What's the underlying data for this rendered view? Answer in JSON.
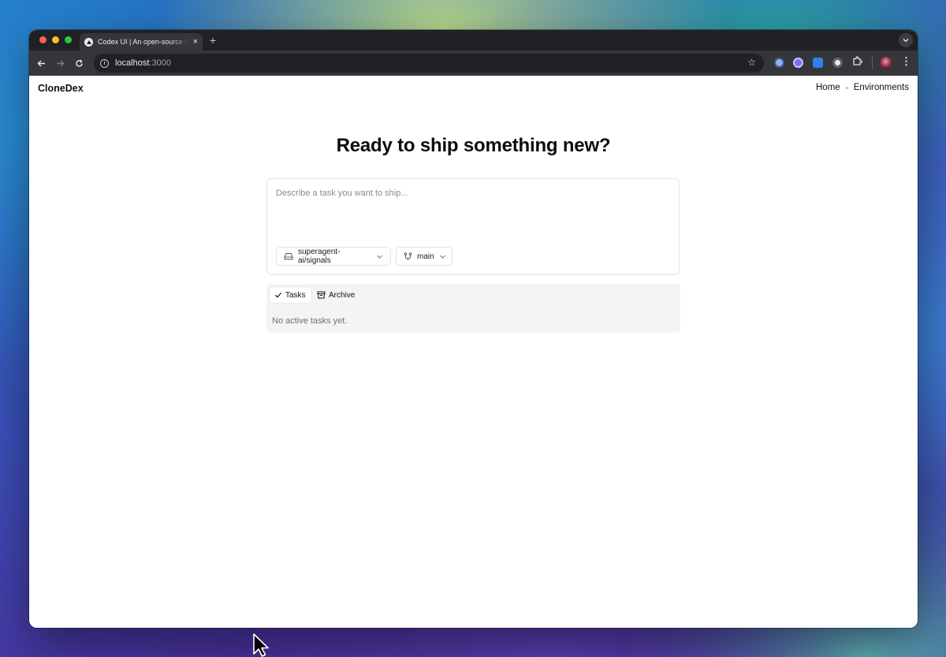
{
  "browser": {
    "tab_title": "Codex UI | An open-source O",
    "tab_close": "×",
    "new_tab": "+",
    "address_host": "localhost",
    "address_port": ":3000"
  },
  "header": {
    "brand": "CloneDex",
    "nav": [
      {
        "label": "Home"
      },
      {
        "label": "Environments"
      }
    ]
  },
  "hero": {
    "title": "Ready to ship something new?"
  },
  "composer": {
    "placeholder": "Describe a task you want to ship...",
    "value": "",
    "repo": "superagent-ai/signals",
    "branch": "main"
  },
  "tasks": {
    "tabs": [
      {
        "label": "Tasks",
        "active": true
      },
      {
        "label": "Archive",
        "active": false
      }
    ],
    "empty_text": "No active tasks yet."
  },
  "icons": {
    "back": "arrow-left-icon",
    "forward": "arrow-right-icon",
    "reload": "reload-icon",
    "bookmark": "star-icon",
    "extensions": "puzzle-icon",
    "menu": "kebab-icon",
    "repo": "drive-icon",
    "branch": "git-branch-icon",
    "tasks": "check-icon",
    "archive": "archive-icon",
    "chevron": "chevron-down-icon"
  }
}
